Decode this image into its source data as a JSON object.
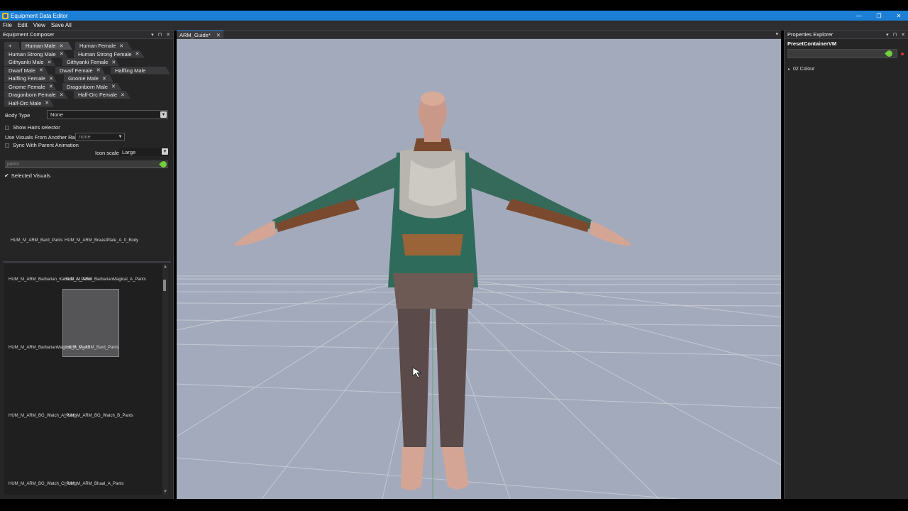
{
  "window": {
    "title": "Equipment Data Editor",
    "minimize": "—",
    "restore": "❐",
    "close": "✕"
  },
  "menu": [
    "File",
    "Edit",
    "View",
    "Save All"
  ],
  "left_panel": {
    "title": "Equipment Composer",
    "header_icons": [
      "▾",
      "⊓",
      "✕"
    ],
    "race_tabs": [
      {
        "label": "+",
        "active": false
      },
      {
        "label": "Human Male",
        "active": true
      },
      {
        "label": "Human Female",
        "active": false
      },
      {
        "label": "Human Strong Male",
        "active": false
      },
      {
        "label": "Human Strong Female",
        "active": false
      },
      {
        "label": "Githyanki Male",
        "active": false
      },
      {
        "label": "Githyanki Female",
        "active": false
      },
      {
        "label": "Dwarf Male",
        "active": false
      },
      {
        "label": "Dwarf Female",
        "active": false
      },
      {
        "label": "Halfling Male",
        "active": false
      },
      {
        "label": "Halfling Female",
        "active": false
      },
      {
        "label": "Gnome Male",
        "active": false
      },
      {
        "label": "Gnome Female",
        "active": false
      },
      {
        "label": "Dragonborn Male",
        "active": false
      },
      {
        "label": "Dragonborn Female",
        "active": false
      },
      {
        "label": "Half-Orc Female",
        "active": false
      },
      {
        "label": "Half-Orc Male",
        "active": false
      }
    ],
    "body_type_label": "Body Type",
    "body_type_value": "None",
    "show_hairs_label": "Show Hairs selector",
    "use_visuals_label": "Use Visuals From Another Race",
    "use_visuals_value": "none",
    "sync_label": "Sync With Parent Animation",
    "icon_scale_label": "Icon scale:",
    "icon_scale_value": "Large",
    "search_value": "pants",
    "selected_visuals_label": "Selected Visuals",
    "selected_visuals": [
      "HUM_M_ARM_Bard_Pants",
      "HUM_M_ARM_BreastPlate_A_0_Body"
    ],
    "visual_list": [
      "HUM_M_ARM_Barbarian_Karlach_A_Pants",
      "HUM_M_ARM_BarbarianMagical_A_Pants",
      "HUM_M_ARM_BarbarianMagical_B_Pants",
      "HUM_M_ARM_Bard_Pants",
      "HUM_M_ARM_BG_Watch_A_Pants",
      "HUM_M_ARM_BG_Watch_B_Pants",
      "HUM_M_ARM_BG_Watch_C_Pants",
      "HUM_M_ARM_Bhaal_A_Pants"
    ]
  },
  "document": {
    "tab_label": "ARM_Guide*",
    "tab_close": "✕",
    "menu_icon": "▾"
  },
  "right_panel": {
    "title": "Properties Explorer",
    "header_icons": [
      "▾",
      "⊓",
      "✕"
    ],
    "container": "PresetContainerVM",
    "tree_item": "02 Colour"
  },
  "colors": {
    "accent": "#1c7fd6",
    "panel_bg": "#252526",
    "viewport_bg": "#a3aabb",
    "pencil": "#6fcf3d"
  }
}
